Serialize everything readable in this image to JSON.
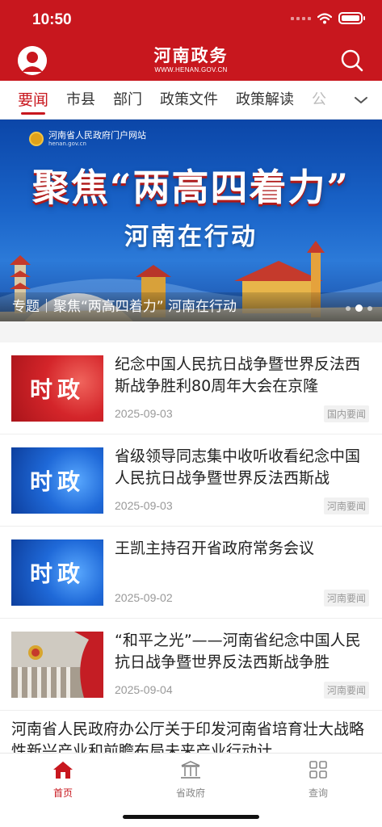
{
  "status_bar": {
    "time": "10:50"
  },
  "header": {
    "title": "河南政务",
    "url": "WWW.HENAN.GOV.CN"
  },
  "tabs": [
    {
      "label": "要闻"
    },
    {
      "label": "市县"
    },
    {
      "label": "部门"
    },
    {
      "label": "政策文件"
    },
    {
      "label": "政策解读"
    },
    {
      "label": "公"
    }
  ],
  "banner": {
    "site_name": "河南省人民政府门户网站",
    "site_url": "henan.gov.cn",
    "headline": "聚焦“两高四着力”",
    "subheadline": "河南在行动",
    "caption": "专题｜聚焦“两高四着力” 河南在行动"
  },
  "news": [
    {
      "thumb_label": "时政",
      "title": "纪念中国人民抗日战争暨世界反法西斯战争胜利80周年大会在京隆",
      "date": "2025-09-03",
      "tag": "国内要闻"
    },
    {
      "thumb_label": "时政",
      "title": "省级领导同志集中收听收看纪念中国人民抗日战争暨世界反法西斯战",
      "date": "2025-09-03",
      "tag": "河南要闻"
    },
    {
      "thumb_label": "时政",
      "title": "王凯主持召开省政府常务会议",
      "date": "2025-09-02",
      "tag": "河南要闻"
    },
    {
      "thumb_label": "",
      "title": "“和平之光”——河南省纪念中国人民抗日战争暨世界反法西斯战争胜",
      "date": "2025-09-04",
      "tag": "河南要闻"
    }
  ],
  "news_wide": {
    "title": "河南省人民政府办公厅关于印发河南省培育壮大战略性新兴产业和前瞻布局未来产业行动计"
  },
  "bottom_nav": [
    {
      "label": "首页",
      "icon": "home-icon"
    },
    {
      "label": "省政府",
      "icon": "government-building-icon"
    },
    {
      "label": "查询",
      "icon": "grid-icon"
    }
  ],
  "colors": {
    "brand_red": "#c8171e",
    "banner_blue": "#1a64c9"
  }
}
